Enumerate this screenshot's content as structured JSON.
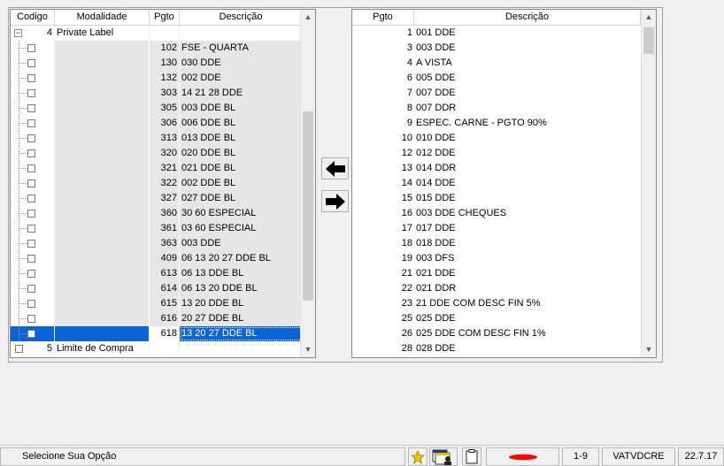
{
  "left_grid": {
    "headers": [
      "Codigo",
      "Modalidade",
      "Pgto",
      "Descrição"
    ],
    "root_open": {
      "expander": "−",
      "code": "4",
      "label": "Private Label"
    },
    "children": [
      {
        "pgto": "102",
        "desc": "FSE - QUARTA"
      },
      {
        "pgto": "130",
        "desc": "030 DDE"
      },
      {
        "pgto": "132",
        "desc": "002 DDE"
      },
      {
        "pgto": "303",
        "desc": "14 21 28 DDE"
      },
      {
        "pgto": "305",
        "desc": "003 DDE BL"
      },
      {
        "pgto": "306",
        "desc": "006 DDE BL"
      },
      {
        "pgto": "313",
        "desc": "013 DDE BL"
      },
      {
        "pgto": "320",
        "desc": "020 DDE BL"
      },
      {
        "pgto": "321",
        "desc": "021 DDE BL"
      },
      {
        "pgto": "322",
        "desc": "002 DDE BL"
      },
      {
        "pgto": "327",
        "desc": "027 DDE BL"
      },
      {
        "pgto": "360",
        "desc": "30 60 ESPECIAL"
      },
      {
        "pgto": "361",
        "desc": "03 60 ESPECIAL"
      },
      {
        "pgto": "363",
        "desc": "003 DDE"
      },
      {
        "pgto": "409",
        "desc": "06 13 20 27 DDE BL"
      },
      {
        "pgto": "613",
        "desc": "06 13 DDE BL"
      },
      {
        "pgto": "614",
        "desc": "06 13 20 DDE BL"
      },
      {
        "pgto": "615",
        "desc": "13 20 DDE BL"
      },
      {
        "pgto": "616",
        "desc": "20 27 DDE BL"
      },
      {
        "pgto": "618",
        "desc": "13 20 27 DDE BL"
      }
    ],
    "selected_index": 19,
    "root_closed": {
      "code": "5",
      "label": "Limite de Compra"
    },
    "scroll_up": "▲",
    "scroll_down": "▼"
  },
  "right_grid": {
    "headers": [
      "Pgto",
      "Descrição"
    ],
    "rows": [
      {
        "pgto": "1",
        "desc": "001 DDE"
      },
      {
        "pgto": "3",
        "desc": "003 DDE"
      },
      {
        "pgto": "4",
        "desc": "A VISTA"
      },
      {
        "pgto": "6",
        "desc": "005 DDE"
      },
      {
        "pgto": "7",
        "desc": "007 DDE"
      },
      {
        "pgto": "8",
        "desc": "007 DDR"
      },
      {
        "pgto": "9",
        "desc": "ESPEC. CARNE - PGTO 90%"
      },
      {
        "pgto": "10",
        "desc": "010 DDE"
      },
      {
        "pgto": "12",
        "desc": "012 DDE"
      },
      {
        "pgto": "13",
        "desc": "014 DDR"
      },
      {
        "pgto": "14",
        "desc": "014 DDE"
      },
      {
        "pgto": "15",
        "desc": "015 DDE"
      },
      {
        "pgto": "16",
        "desc": "003 DDE CHEQUES"
      },
      {
        "pgto": "17",
        "desc": "017 DDE"
      },
      {
        "pgto": "18",
        "desc": "018 DDE"
      },
      {
        "pgto": "19",
        "desc": "003 DFS"
      },
      {
        "pgto": "21",
        "desc": "021 DDE"
      },
      {
        "pgto": "22",
        "desc": "021 DDR"
      },
      {
        "pgto": "23",
        "desc": "21 DDE COM DESC FIN 5%"
      },
      {
        "pgto": "25",
        "desc": "025 DDE"
      },
      {
        "pgto": "26",
        "desc": "025 DDE COM DESC FIN 1%"
      },
      {
        "pgto": "28",
        "desc": "028 DDE"
      }
    ],
    "scroll_up": "▲",
    "scroll_down": "▼"
  },
  "status_bar": {
    "message": "Selecione Sua Opção",
    "page": "1-9",
    "program": "VATVDCRE",
    "version": "22.7.17",
    "redacted_color": "#ff0000",
    "icons": [
      "star-icon",
      "windows-user-icon",
      "clipboard-icon"
    ]
  },
  "colors": {
    "selection": "#0a64d4",
    "row_shade": "#e6e6e6"
  }
}
